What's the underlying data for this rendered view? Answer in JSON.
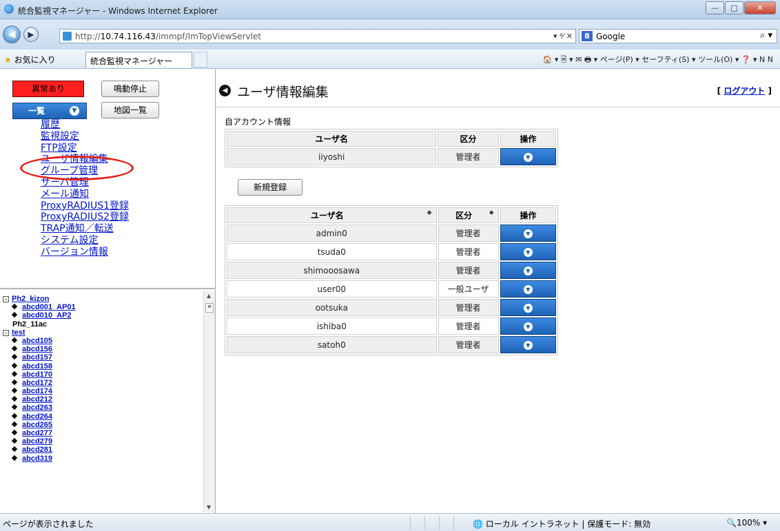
{
  "window": {
    "title": "統合監視マネージャー - Windows Internet Explorer",
    "controls": {
      "minimize": "—",
      "maximize": "□",
      "close": "✕"
    }
  },
  "address_bar": {
    "url_prefix": "http://",
    "url_host": "10.74.116.43",
    "url_path": "/immpf/ImTopViewServlet",
    "tools": "▾ ⁴⁄ ✕",
    "search_engine": "Google",
    "search_icon": "⌕ ▾"
  },
  "favorites_bar": {
    "favorites_label": "お気に入り",
    "tab_label": "統合監視マネージャー",
    "commands": "🏠 ▾ 🗎 ▾ ✉ 🖶 ▾ ページ(P) ▾ セーフティ(S) ▾ ツール(O) ▾ ❓ ▾ N N"
  },
  "sidebar": {
    "alarm_button": "異常あり",
    "stop_button": "鳴動停止",
    "list_button": "一覧",
    "map_button": "地図一覧",
    "menu": [
      "履歴",
      "監視設定",
      "FTP設定",
      "ユーザ情報編集",
      "グループ管理",
      "サーバ管理",
      "メール通知",
      "ProxyRADIUS1登録",
      "ProxyRADIUS2登録",
      "TRAP通知／転送",
      "システム設定",
      "バージョン情報"
    ]
  },
  "tree": {
    "groups": [
      {
        "name": "Ph2_kizon",
        "children": [
          "abcd001_AP01",
          "abcd010_AP2"
        ]
      },
      {
        "name": "Ph2_11ac",
        "children": []
      },
      {
        "name": "test",
        "children": [
          "abcd105",
          "abcd156",
          "abcd157",
          "abcd158",
          "abcd170",
          "abcd172",
          "abcd174",
          "abcd212",
          "abcd263",
          "abcd264",
          "abcd265",
          "abcd277",
          "abcd279",
          "abcd281",
          "abcd319"
        ]
      }
    ]
  },
  "main": {
    "title": "ユーザ情報編集",
    "logout": "ログアウト",
    "own_account_label": "自アカウント情報",
    "columns": {
      "user": "ユーザ名",
      "role": "区分",
      "action": "操作"
    },
    "own_account": [
      {
        "user": "iiyoshi",
        "role": "管理者"
      }
    ],
    "new_button": "新規登録",
    "users": [
      {
        "user": "admin0",
        "role": "管理者"
      },
      {
        "user": "tsuda0",
        "role": "管理者"
      },
      {
        "user": "shimooosawa",
        "role": "管理者"
      },
      {
        "user": "user00",
        "role": "一般ユーザ"
      },
      {
        "user": "ootsuka",
        "role": "管理者"
      },
      {
        "user": "ishiba0",
        "role": "管理者"
      },
      {
        "user": "satoh0",
        "role": "管理者"
      }
    ]
  },
  "status_bar": {
    "message": "ページが表示されました",
    "zone": "ローカル イントラネット | 保護モード: 無効",
    "zoom": "100%"
  },
  "colors": {
    "alarm": "#ff1f1f",
    "action_button": "#1e63b7",
    "link": "#0014c8",
    "highlight_circle": "#e2231a"
  }
}
